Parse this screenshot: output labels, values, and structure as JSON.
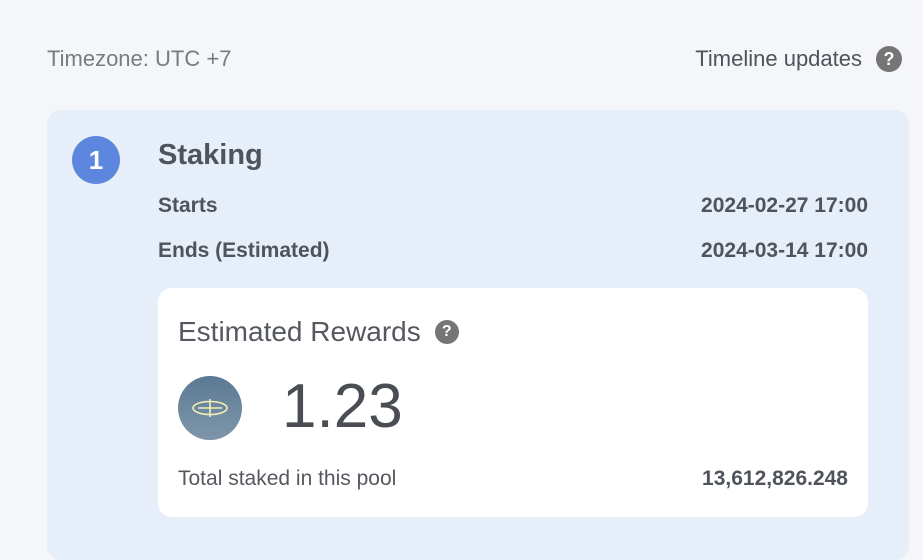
{
  "header": {
    "timezone_text": "Timezone: UTC +7",
    "timeline_updates_label": "Timeline updates",
    "help_glyph": "?"
  },
  "stage": {
    "step_number": "1",
    "title": "Staking",
    "starts_label": "Starts",
    "starts_value": "2024-02-27 17:00",
    "ends_label": "Ends (Estimated)",
    "ends_value": "2024-03-14 17:00"
  },
  "rewards": {
    "title": "Estimated Rewards",
    "help_glyph": "?",
    "token_icon": "token-logo-icon",
    "amount": "1.23",
    "total_label": "Total staked in this pool",
    "total_value": "13,612,826.248"
  },
  "colors": {
    "page_background": "#f4f6f9",
    "card_background": "#e6eef9",
    "panel_background": "#ffffff",
    "step_badge": "#5d86de",
    "help_icon": "#757575"
  }
}
